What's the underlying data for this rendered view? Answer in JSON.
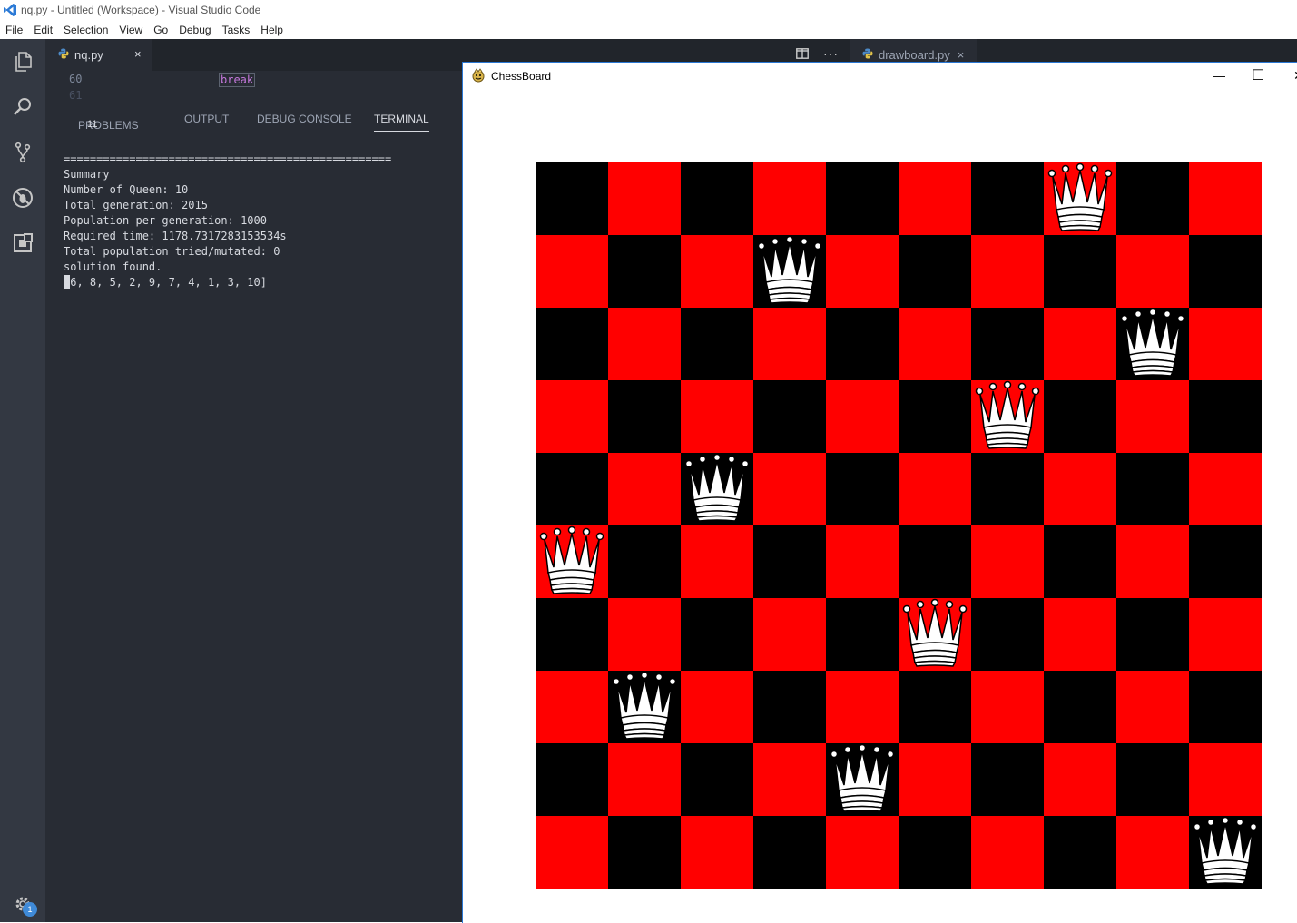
{
  "window": {
    "title": "nq.py - Untitled (Workspace) - Visual Studio Code"
  },
  "menu": [
    "File",
    "Edit",
    "Selection",
    "View",
    "Go",
    "Debug",
    "Tasks",
    "Help"
  ],
  "activity_icons": [
    "explorer-icon",
    "search-icon",
    "source-control-icon",
    "debug-icon",
    "extensions-icon",
    "gear-icon"
  ],
  "settings_badge": "1",
  "tabs": {
    "active": "nq.py",
    "close_glyph": "×",
    "right": "drawboard.py",
    "right_close_glyph": "×",
    "more_glyph": "···"
  },
  "code": {
    "lines": [
      {
        "number": "60",
        "keyword": "break"
      },
      {
        "number": "61",
        "keyword": ""
      }
    ]
  },
  "panel": {
    "tabs": [
      "PROBLEMS",
      "OUTPUT",
      "DEBUG CONSOLE",
      "TERMINAL"
    ],
    "problems_count": "11",
    "active_tab": "TERMINAL"
  },
  "terminal": {
    "lines": [
      "==================================================",
      "Summary",
      "Number of Queen: 10",
      "Total generation: 2015",
      "Population per generation: 1000",
      "Required time: 1178.7317283153534s",
      "Total population tried/mutated: 0",
      "solution found.",
      "[6, 8, 5, 2, 9, 7, 4, 1, 3, 10]"
    ]
  },
  "chessboard": {
    "title": "ChessBoard",
    "size": 10,
    "colors": {
      "light": "#ff0000",
      "dark": "#000000",
      "queen": "#ffffff"
    },
    "queen_columns_by_row": [
      8,
      4,
      9,
      7,
      3,
      1,
      6,
      2,
      5,
      10
    ],
    "window_controls": [
      "—",
      "☐",
      "✕"
    ]
  }
}
